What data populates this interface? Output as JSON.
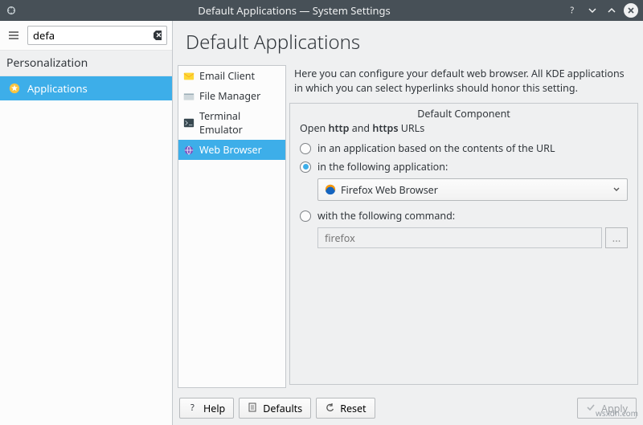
{
  "window": {
    "title": "Default Applications — System Settings"
  },
  "sidebar": {
    "search_value": "defa",
    "section": "Personalization",
    "item_label": "Applications"
  },
  "page": {
    "title": "Default Applications",
    "description": "Here you can configure your default web browser. All KDE applications in which you can select hyperlinks should honor this setting."
  },
  "categories": {
    "email": "Email Client",
    "file": "File Manager",
    "terminal": "Terminal Emulator",
    "web": "Web Browser"
  },
  "group": {
    "legend": "Default Component",
    "open_prefix": "Open ",
    "open_mid": " and ",
    "open_http": "http",
    "open_https": "https",
    "open_suffix": " URLs",
    "r1": "in an application based on the contents of the URL",
    "r2": "in the following application:",
    "combo_value": "Firefox Web Browser",
    "r3": "with the following command:",
    "cmd_placeholder": "firefox",
    "browse": "..."
  },
  "footer": {
    "help": "Help",
    "defaults": "Defaults",
    "reset": "Reset",
    "apply": "Apply"
  },
  "watermark": "wsxdn.com"
}
